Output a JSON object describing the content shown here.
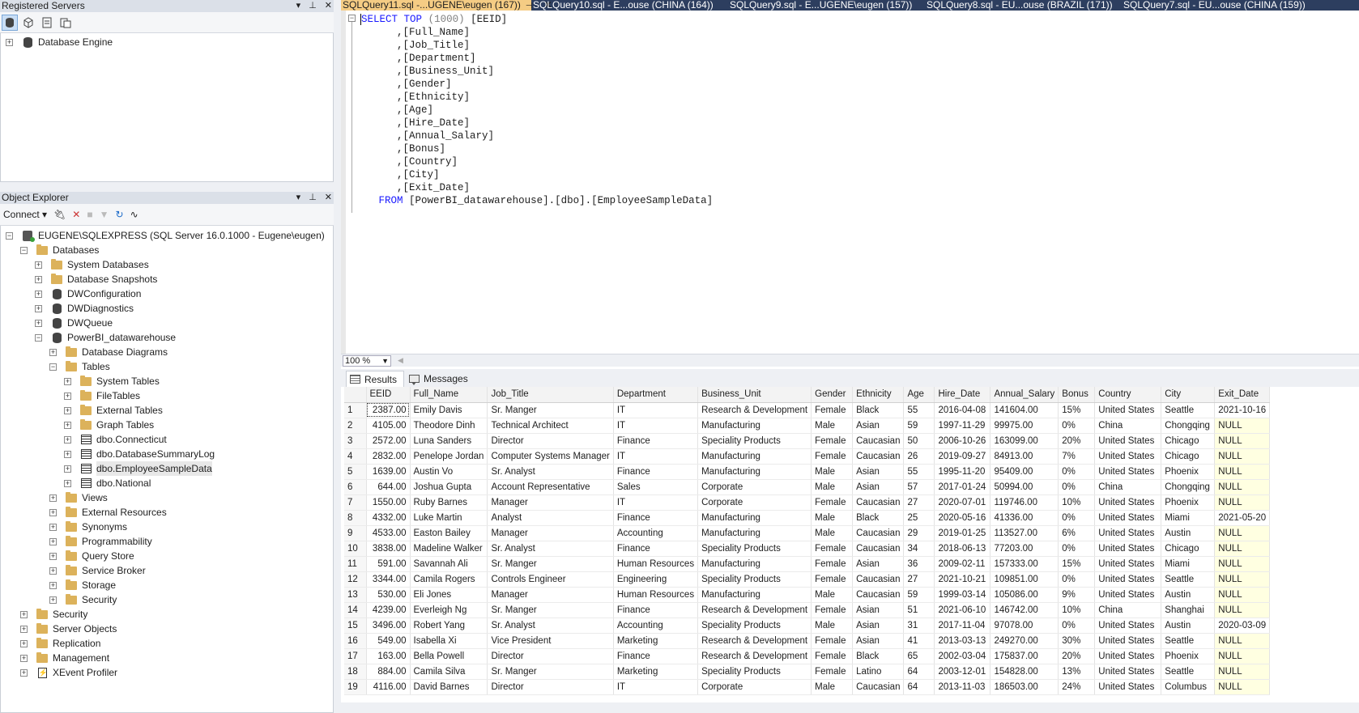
{
  "registered_servers": {
    "title": "Registered Servers",
    "tree": [
      {
        "label": "Database Engine"
      }
    ]
  },
  "object_explorer": {
    "title": "Object Explorer",
    "connect_label": "Connect",
    "tree": [
      {
        "level": 0,
        "exp": "−",
        "icon": "server",
        "label": "EUGENE\\SQLEXPRESS (SQL Server 16.0.1000 - Eugene\\eugen)"
      },
      {
        "level": 1,
        "exp": "−",
        "icon": "folder",
        "label": "Databases"
      },
      {
        "level": 2,
        "exp": "+",
        "icon": "folder",
        "label": "System Databases"
      },
      {
        "level": 2,
        "exp": "+",
        "icon": "folder",
        "label": "Database Snapshots"
      },
      {
        "level": 2,
        "exp": "+",
        "icon": "db",
        "label": "DWConfiguration"
      },
      {
        "level": 2,
        "exp": "+",
        "icon": "db",
        "label": "DWDiagnostics"
      },
      {
        "level": 2,
        "exp": "+",
        "icon": "db",
        "label": "DWQueue"
      },
      {
        "level": 2,
        "exp": "−",
        "icon": "db",
        "label": "PowerBI_datawarehouse"
      },
      {
        "level": 3,
        "exp": "+",
        "icon": "folder",
        "label": "Database Diagrams"
      },
      {
        "level": 3,
        "exp": "−",
        "icon": "folder",
        "label": "Tables"
      },
      {
        "level": 4,
        "exp": "+",
        "icon": "folder",
        "label": "System Tables"
      },
      {
        "level": 4,
        "exp": "+",
        "icon": "folder",
        "label": "FileTables"
      },
      {
        "level": 4,
        "exp": "+",
        "icon": "folder",
        "label": "External Tables"
      },
      {
        "level": 4,
        "exp": "+",
        "icon": "folder",
        "label": "Graph Tables"
      },
      {
        "level": 4,
        "exp": "+",
        "icon": "table",
        "label": "dbo.Connecticut"
      },
      {
        "level": 4,
        "exp": "+",
        "icon": "table",
        "label": "dbo.DatabaseSummaryLog"
      },
      {
        "level": 4,
        "exp": "+",
        "icon": "table",
        "label": "dbo.EmployeeSampleData",
        "selected": true
      },
      {
        "level": 4,
        "exp": "+",
        "icon": "table",
        "label": "dbo.National"
      },
      {
        "level": 3,
        "exp": "+",
        "icon": "folder",
        "label": "Views"
      },
      {
        "level": 3,
        "exp": "+",
        "icon": "folder",
        "label": "External Resources"
      },
      {
        "level": 3,
        "exp": "+",
        "icon": "folder",
        "label": "Synonyms"
      },
      {
        "level": 3,
        "exp": "+",
        "icon": "folder",
        "label": "Programmability"
      },
      {
        "level": 3,
        "exp": "+",
        "icon": "folder",
        "label": "Query Store"
      },
      {
        "level": 3,
        "exp": "+",
        "icon": "folder",
        "label": "Service Broker"
      },
      {
        "level": 3,
        "exp": "+",
        "icon": "folder",
        "label": "Storage"
      },
      {
        "level": 3,
        "exp": "+",
        "icon": "folder",
        "label": "Security"
      },
      {
        "level": 1,
        "exp": "+",
        "icon": "folder",
        "label": "Security"
      },
      {
        "level": 1,
        "exp": "+",
        "icon": "folder",
        "label": "Server Objects"
      },
      {
        "level": 1,
        "exp": "+",
        "icon": "folder",
        "label": "Replication"
      },
      {
        "level": 1,
        "exp": "+",
        "icon": "folder",
        "label": "Management"
      },
      {
        "level": 1,
        "exp": "+",
        "icon": "xevent",
        "label": "XEvent Profiler"
      }
    ]
  },
  "tabs": [
    {
      "label": "SQLQuery11.sql -...UGENE\\eugen (167))",
      "active": true
    },
    {
      "label": "SQLQuery10.sql - E...ouse (CHINA (164))"
    },
    {
      "label": "SQLQuery9.sql - E...UGENE\\eugen (157))"
    },
    {
      "label": "SQLQuery8.sql - EU...ouse (BRAZIL (171))"
    },
    {
      "label": "SQLQuery7.sql - EU...ouse (CHINA (159))"
    }
  ],
  "query": {
    "select_kw": "SELECT",
    "top_kw": "TOP",
    "top_value": "(1000)",
    "first_column": "[EEID]",
    "columns": [
      ",[Full_Name]",
      ",[Job_Title]",
      ",[Department]",
      ",[Business_Unit]",
      ",[Gender]",
      ",[Ethnicity]",
      ",[Age]",
      ",[Hire_Date]",
      ",[Annual_Salary]",
      ",[Bonus]",
      ",[Country]",
      ",[City]",
      ",[Exit_Date]"
    ],
    "from_kw": "FROM",
    "from_target": "[PowerBI_datawarehouse].[dbo].[EmployeeSampleData]"
  },
  "zoom": "100 %",
  "result_tabs": {
    "results": "Results",
    "messages": "Messages"
  },
  "results": {
    "columns": [
      "EEID",
      "Full_Name",
      "Job_Title",
      "Department",
      "Business_Unit",
      "Gender",
      "Ethnicity",
      "Age",
      "Hire_Date",
      "Annual_Salary",
      "Bonus",
      "Country",
      "City",
      "Exit_Date"
    ],
    "rows": [
      [
        "1",
        "2387.00",
        "Emily Davis",
        "Sr. Manger",
        "IT",
        "Research & Development",
        "Female",
        "Black",
        "55",
        "2016-04-08",
        "141604.00",
        "15%",
        "United States",
        "Seattle",
        "2021-10-16"
      ],
      [
        "2",
        "4105.00",
        "Theodore Dinh",
        "Technical Architect",
        "IT",
        "Manufacturing",
        "Male",
        "Asian",
        "59",
        "1997-11-29",
        "99975.00",
        "0%",
        "China",
        "Chongqing",
        "NULL"
      ],
      [
        "3",
        "2572.00",
        "Luna Sanders",
        "Director",
        "Finance",
        "Speciality Products",
        "Female",
        "Caucasian",
        "50",
        "2006-10-26",
        "163099.00",
        "20%",
        "United States",
        "Chicago",
        "NULL"
      ],
      [
        "4",
        "2832.00",
        "Penelope Jordan",
        "Computer Systems Manager",
        "IT",
        "Manufacturing",
        "Female",
        "Caucasian",
        "26",
        "2019-09-27",
        "84913.00",
        "7%",
        "United States",
        "Chicago",
        "NULL"
      ],
      [
        "5",
        "1639.00",
        "Austin Vo",
        "Sr. Analyst",
        "Finance",
        "Manufacturing",
        "Male",
        "Asian",
        "55",
        "1995-11-20",
        "95409.00",
        "0%",
        "United States",
        "Phoenix",
        "NULL"
      ],
      [
        "6",
        "644.00",
        "Joshua Gupta",
        "Account Representative",
        "Sales",
        "Corporate",
        "Male",
        "Asian",
        "57",
        "2017-01-24",
        "50994.00",
        "0%",
        "China",
        "Chongqing",
        "NULL"
      ],
      [
        "7",
        "1550.00",
        "Ruby Barnes",
        "Manager",
        "IT",
        "Corporate",
        "Female",
        "Caucasian",
        "27",
        "2020-07-01",
        "119746.00",
        "10%",
        "United States",
        "Phoenix",
        "NULL"
      ],
      [
        "8",
        "4332.00",
        "Luke Martin",
        "Analyst",
        "Finance",
        "Manufacturing",
        "Male",
        "Black",
        "25",
        "2020-05-16",
        "41336.00",
        "0%",
        "United States",
        "Miami",
        "2021-05-20"
      ],
      [
        "9",
        "4533.00",
        "Easton Bailey",
        "Manager",
        "Accounting",
        "Manufacturing",
        "Male",
        "Caucasian",
        "29",
        "2019-01-25",
        "113527.00",
        "6%",
        "United States",
        "Austin",
        "NULL"
      ],
      [
        "10",
        "3838.00",
        "Madeline Walker",
        "Sr. Analyst",
        "Finance",
        "Speciality Products",
        "Female",
        "Caucasian",
        "34",
        "2018-06-13",
        "77203.00",
        "0%",
        "United States",
        "Chicago",
        "NULL"
      ],
      [
        "11",
        "591.00",
        "Savannah Ali",
        "Sr. Manger",
        "Human Resources",
        "Manufacturing",
        "Female",
        "Asian",
        "36",
        "2009-02-11",
        "157333.00",
        "15%",
        "United States",
        "Miami",
        "NULL"
      ],
      [
        "12",
        "3344.00",
        "Camila Rogers",
        "Controls Engineer",
        "Engineering",
        "Speciality Products",
        "Female",
        "Caucasian",
        "27",
        "2021-10-21",
        "109851.00",
        "0%",
        "United States",
        "Seattle",
        "NULL"
      ],
      [
        "13",
        "530.00",
        "Eli Jones",
        "Manager",
        "Human Resources",
        "Manufacturing",
        "Male",
        "Caucasian",
        "59",
        "1999-03-14",
        "105086.00",
        "9%",
        "United States",
        "Austin",
        "NULL"
      ],
      [
        "14",
        "4239.00",
        "Everleigh Ng",
        "Sr. Manger",
        "Finance",
        "Research & Development",
        "Female",
        "Asian",
        "51",
        "2021-06-10",
        "146742.00",
        "10%",
        "China",
        "Shanghai",
        "NULL"
      ],
      [
        "15",
        "3496.00",
        "Robert Yang",
        "Sr. Analyst",
        "Accounting",
        "Speciality Products",
        "Male",
        "Asian",
        "31",
        "2017-11-04",
        "97078.00",
        "0%",
        "United States",
        "Austin",
        "2020-03-09"
      ],
      [
        "16",
        "549.00",
        "Isabella Xi",
        "Vice President",
        "Marketing",
        "Research & Development",
        "Female",
        "Asian",
        "41",
        "2013-03-13",
        "249270.00",
        "30%",
        "United States",
        "Seattle",
        "NULL"
      ],
      [
        "17",
        "163.00",
        "Bella Powell",
        "Director",
        "Finance",
        "Research & Development",
        "Female",
        "Black",
        "65",
        "2002-03-04",
        "175837.00",
        "20%",
        "United States",
        "Phoenix",
        "NULL"
      ],
      [
        "18",
        "884.00",
        "Camila Silva",
        "Sr. Manger",
        "Marketing",
        "Speciality Products",
        "Female",
        "Latino",
        "64",
        "2003-12-01",
        "154828.00",
        "13%",
        "United States",
        "Seattle",
        "NULL"
      ],
      [
        "19",
        "4116.00",
        "David Barnes",
        "Director",
        "IT",
        "Corporate",
        "Male",
        "Caucasian",
        "64",
        "2013-11-03",
        "186503.00",
        "24%",
        "United States",
        "Columbus",
        "NULL"
      ]
    ]
  }
}
